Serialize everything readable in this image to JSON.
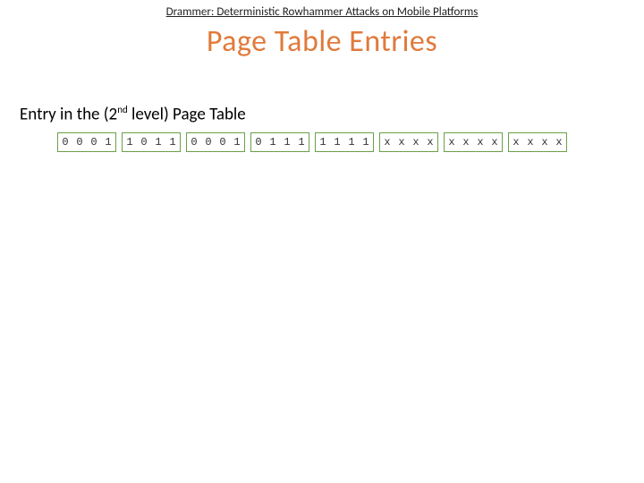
{
  "paper_title": "Drammer: Deterministic Rowhammer Attacks on Mobile Platforms",
  "slide_title": "Page Table Entries",
  "heading_before_sup": "Entry in the (2",
  "heading_sup": "nd",
  "heading_after_sup": " level) Page Table",
  "groups": [
    [
      "0",
      "0",
      "0",
      "1"
    ],
    [
      "1",
      "0",
      "1",
      "1"
    ],
    [
      "0",
      "0",
      "0",
      "1"
    ],
    [
      "0",
      "1",
      "1",
      "1"
    ],
    [
      "1",
      "1",
      "1",
      "1"
    ],
    [
      "x",
      "x",
      "x",
      "x"
    ],
    [
      "x",
      "x",
      "x",
      "x"
    ],
    [
      "x",
      "x",
      "x",
      "x"
    ]
  ]
}
